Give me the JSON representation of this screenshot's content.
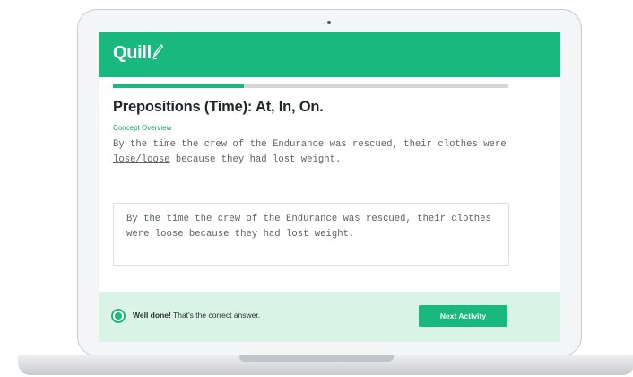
{
  "app": {
    "logo_text": "Quill",
    "logo_icon": "pen-icon",
    "brand_color": "#18b87f"
  },
  "progress": {
    "fraction": 0.33
  },
  "activity": {
    "title": "Prepositions (Time): At, In, On.",
    "concept_link": "Concept Overview",
    "prompt_before": "By the time the crew of the Endurance was rescued, their clothes were ",
    "prompt_choice": "lose/loose",
    "prompt_after": " because they had lost weight.",
    "answer": "By the time the crew of the Endurance was rescued, their clothes were loose because they had lost weight."
  },
  "feedback": {
    "icon": "check-circle-icon",
    "strong": "Well done!",
    "message": " That's the correct answer.",
    "background_color": "#d9f4e7"
  },
  "actions": {
    "next_label": "Next Activity"
  }
}
